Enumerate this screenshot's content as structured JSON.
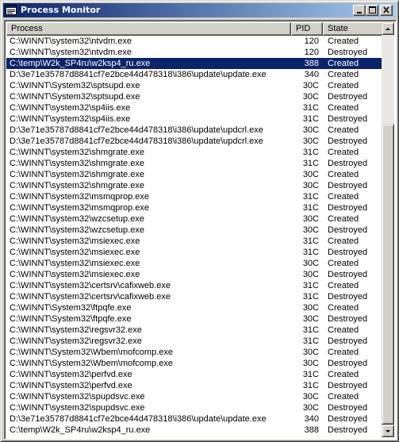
{
  "window": {
    "title": "Process Monitor",
    "icon": "window-app-icon",
    "controls": {
      "minimize_icon": "minimize-icon",
      "maximize_icon": "maximize-icon",
      "close_icon": "close-icon"
    }
  },
  "colors": {
    "titlebar_start": "#0a246a",
    "titlebar_end": "#a6caf0",
    "selection": "#0a246a"
  },
  "table": {
    "columns": [
      "Process",
      "PID",
      "State"
    ],
    "selected_index": 2,
    "rows": [
      {
        "process": "C:\\WINNT\\system32\\ntvdm.exe",
        "pid": "120",
        "state": "Created"
      },
      {
        "process": "C:\\WINNT\\system32\\ntvdm.exe",
        "pid": "120",
        "state": "Destroyed"
      },
      {
        "process": "C:\\temp\\W2k_SP4ru\\w2ksp4_ru.exe",
        "pid": "388",
        "state": "Created"
      },
      {
        "process": "D:\\3e71e35787d8841cf7e2bce44d478318\\i386\\update\\update.exe",
        "pid": "340",
        "state": "Created"
      },
      {
        "process": "C:\\WINNT\\System32\\sptsupd.exe",
        "pid": "30C",
        "state": "Created"
      },
      {
        "process": "C:\\WINNT\\System32\\sptsupd.exe",
        "pid": "30C",
        "state": "Destroyed"
      },
      {
        "process": "C:\\WINNT\\system32\\sp4iis.exe",
        "pid": "31C",
        "state": "Created"
      },
      {
        "process": "C:\\WINNT\\system32\\sp4iis.exe",
        "pid": "31C",
        "state": "Destroyed"
      },
      {
        "process": "D:\\3e71e35787d8841cf7e2bce44d478318\\i386\\update\\updcrl.exe",
        "pid": "30C",
        "state": "Created"
      },
      {
        "process": "D:\\3e71e35787d8841cf7e2bce44d478318\\i386\\update\\updcrl.exe",
        "pid": "30C",
        "state": "Destroyed"
      },
      {
        "process": "C:\\WINNT\\system32\\shmgrate.exe",
        "pid": "31C",
        "state": "Created"
      },
      {
        "process": "C:\\WINNT\\system32\\shmgrate.exe",
        "pid": "31C",
        "state": "Destroyed"
      },
      {
        "process": "C:\\WINNT\\system32\\shmgrate.exe",
        "pid": "30C",
        "state": "Created"
      },
      {
        "process": "C:\\WINNT\\system32\\shmgrate.exe",
        "pid": "30C",
        "state": "Destroyed"
      },
      {
        "process": "C:\\WINNT\\system32\\msmqprop.exe",
        "pid": "31C",
        "state": "Created"
      },
      {
        "process": "C:\\WINNT\\system32\\msmqprop.exe",
        "pid": "31C",
        "state": "Destroyed"
      },
      {
        "process": "C:\\WINNT\\system32\\wzcsetup.exe",
        "pid": "30C",
        "state": "Created"
      },
      {
        "process": "C:\\WINNT\\system32\\wzcsetup.exe",
        "pid": "30C",
        "state": "Destroyed"
      },
      {
        "process": "C:\\WINNT\\system32\\msiexec.exe",
        "pid": "31C",
        "state": "Created"
      },
      {
        "process": "C:\\WINNT\\system32\\msiexec.exe",
        "pid": "31C",
        "state": "Destroyed"
      },
      {
        "process": "C:\\WINNT\\system32\\msiexec.exe",
        "pid": "30C",
        "state": "Created"
      },
      {
        "process": "C:\\WINNT\\system32\\msiexec.exe",
        "pid": "30C",
        "state": "Destroyed"
      },
      {
        "process": "C:\\WINNT\\system32\\certsrv\\cafixweb.exe",
        "pid": "31C",
        "state": "Created"
      },
      {
        "process": "C:\\WINNT\\system32\\certsrv\\cafixweb.exe",
        "pid": "31C",
        "state": "Destroyed"
      },
      {
        "process": "C:\\WINNT\\System32\\ftpqfe.exe",
        "pid": "30C",
        "state": "Created"
      },
      {
        "process": "C:\\WINNT\\System32\\ftpqfe.exe",
        "pid": "30C",
        "state": "Destroyed"
      },
      {
        "process": "C:\\WINNT\\system32\\regsvr32.exe",
        "pid": "31C",
        "state": "Created"
      },
      {
        "process": "C:\\WINNT\\system32\\regsvr32.exe",
        "pid": "31C",
        "state": "Destroyed"
      },
      {
        "process": "C:\\WINNT\\System32\\Wbem\\mofcomp.exe",
        "pid": "30C",
        "state": "Created"
      },
      {
        "process": "C:\\WINNT\\System32\\Wbem\\mofcomp.exe",
        "pid": "30C",
        "state": "Destroyed"
      },
      {
        "process": "C:\\WINNT\\system32\\perfvd.exe",
        "pid": "31C",
        "state": "Created"
      },
      {
        "process": "C:\\WINNT\\system32\\perfvd.exe",
        "pid": "31C",
        "state": "Destroyed"
      },
      {
        "process": "C:\\WINNT\\system32\\spupdsvc.exe",
        "pid": "30C",
        "state": "Created"
      },
      {
        "process": "C:\\WINNT\\system32\\spupdsvc.exe",
        "pid": "30C",
        "state": "Destroyed"
      },
      {
        "process": "D:\\3e71e35787d8841cf7e2bce44d478318\\i386\\update\\update.exe",
        "pid": "340",
        "state": "Destroyed"
      },
      {
        "process": "C:\\temp\\W2k_SP4ru\\w2ksp4_ru.exe",
        "pid": "388",
        "state": "Destroyed"
      }
    ]
  },
  "scrollbar": {
    "up_icon": "scroll-up-arrow-icon",
    "down_icon": "scroll-down-arrow-icon"
  }
}
